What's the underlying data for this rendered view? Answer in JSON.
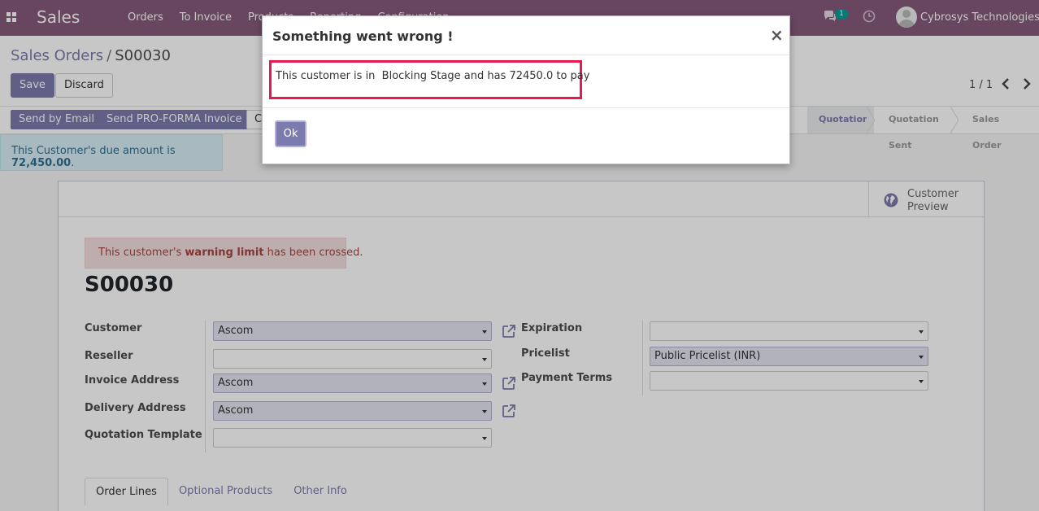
{
  "navbar": {
    "app_name": "Sales",
    "menu": [
      "Orders",
      "To Invoice",
      "Products",
      "Reporting",
      "Configuration"
    ],
    "chat_count": "1",
    "company": "Cybrosys Technologies"
  },
  "breadcrumb": {
    "parent": "Sales Orders",
    "separator": "/",
    "current": "S00030"
  },
  "buttons": {
    "save": "Save",
    "discard": "Discard"
  },
  "pager": {
    "value": "1 / 1"
  },
  "statusbar": {
    "send_email": "Send by Email",
    "send_proforma": "Send PRO-FORMA Invoice",
    "cancel_partial": "C",
    "stages": [
      "Quotation",
      "Quotation Sent",
      "Sales Order"
    ],
    "active_stage": "Quotation"
  },
  "due_alert": {
    "prefix": "This Customer's due amount is ",
    "amount": "72,450.00",
    "suffix": "."
  },
  "sheet": {
    "customer_preview": "Customer Preview",
    "warning": {
      "prefix": "This customer's ",
      "bold": "warning limit",
      "suffix": " has been crossed."
    },
    "order_name": "S00030",
    "fields": {
      "customer": {
        "label": "Customer",
        "value": "Ascom"
      },
      "reseller": {
        "label": "Reseller",
        "value": ""
      },
      "invoice_address": {
        "label": "Invoice Address",
        "value": "Ascom"
      },
      "delivery_address": {
        "label": "Delivery Address",
        "value": "Ascom"
      },
      "quotation_template": {
        "label": "Quotation Template",
        "value": ""
      },
      "expiration": {
        "label": "Expiration",
        "value": ""
      },
      "pricelist": {
        "label": "Pricelist",
        "value": "Public Pricelist (INR)"
      },
      "payment_terms": {
        "label": "Payment Terms",
        "value": ""
      }
    },
    "tabs": [
      "Order Lines",
      "Optional Products",
      "Other Info"
    ],
    "active_tab": "Order Lines"
  },
  "modal": {
    "title": "Something went wrong !",
    "close": "×",
    "message": "This customer is in  Blocking Stage and has 72450.0 to pay",
    "ok": "Ok",
    "highlight_color": "#e8194f"
  },
  "colors": {
    "navbar": "#875a7b",
    "primary": "#7c7bad"
  }
}
